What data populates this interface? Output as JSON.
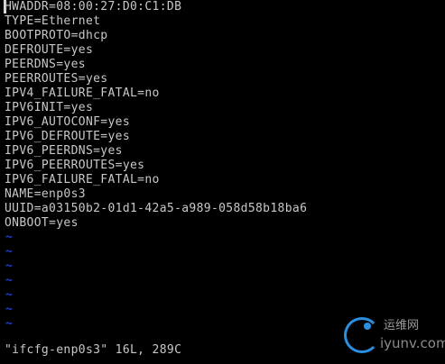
{
  "file_lines": [
    "HWADDR=08:00:27:D0:C1:DB",
    "TYPE=Ethernet",
    "BOOTPROTO=dhcp",
    "DEFROUTE=yes",
    "PEERDNS=yes",
    "PEERROUTES=yes",
    "IPV4_FAILURE_FATAL=no",
    "IPV6INIT=yes",
    "IPV6_AUTOCONF=yes",
    "IPV6_DEFROUTE=yes",
    "IPV6_PEERDNS=yes",
    "IPV6_PEERROUTES=yes",
    "IPV6_FAILURE_FATAL=no",
    "NAME=enp0s3",
    "UUID=a03150b2-01d1-42a5-a989-058d58b18ba6",
    "ONBOOT=yes"
  ],
  "empty_line_marker": "~",
  "status_line": "\"ifcfg-enp0s3\" 16L, 289C",
  "watermark": {
    "cn": "运维网",
    "url": "iyunv.com"
  },
  "colors": {
    "background": "#000000",
    "text": "#c8c8c8",
    "tilde": "#1f3fd8",
    "cursor": "#d6d6d6"
  }
}
